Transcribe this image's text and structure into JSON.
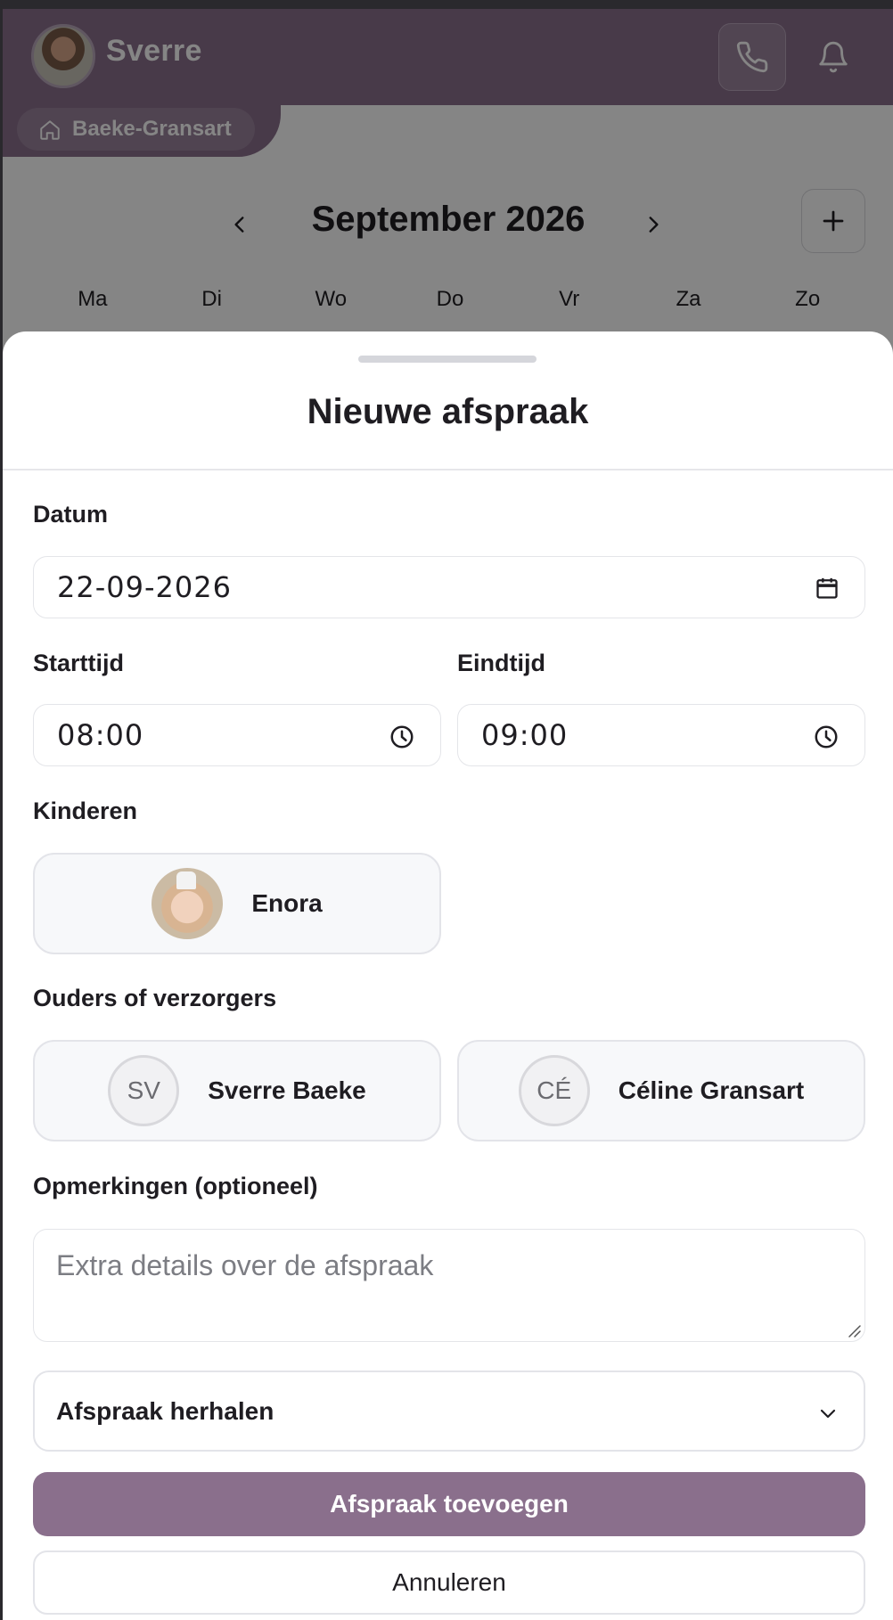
{
  "header": {
    "user_name": "Sverre",
    "household": "Baeke-Gransart",
    "icons": [
      "avatar",
      "phone-icon",
      "bell-icon",
      "home-icon"
    ]
  },
  "calendar": {
    "month_title": "September 2026",
    "weekdays": [
      "Ma",
      "Di",
      "Wo",
      "Do",
      "Vr",
      "Za",
      "Zo"
    ]
  },
  "sheet": {
    "title": "Nieuwe afspraak",
    "date": {
      "label": "Datum",
      "value": "22-09-2026"
    },
    "start": {
      "label": "Starttijd",
      "value": "08:00"
    },
    "end": {
      "label": "Eindtijd",
      "value": "09:00"
    },
    "children": {
      "label": "Kinderen",
      "items": [
        {
          "name": "Enora"
        }
      ]
    },
    "parents": {
      "label": "Ouders of verzorgers",
      "items": [
        {
          "initials": "SV",
          "name": "Sverre Baeke"
        },
        {
          "initials": "CÉ",
          "name": "Céline Gransart"
        }
      ]
    },
    "notes": {
      "label": "Opmerkingen (optioneel)",
      "placeholder": "Extra details over de afspraak"
    },
    "repeat_label": "Afspraak herhalen",
    "submit_label": "Afspraak toevoegen",
    "cancel_label": "Annuleren"
  },
  "colors": {
    "brand": "#8a6f8c",
    "overlay": "rgba(0,0,0,0.48)",
    "text": "#1f1d22",
    "border": "#e3e4e9"
  }
}
